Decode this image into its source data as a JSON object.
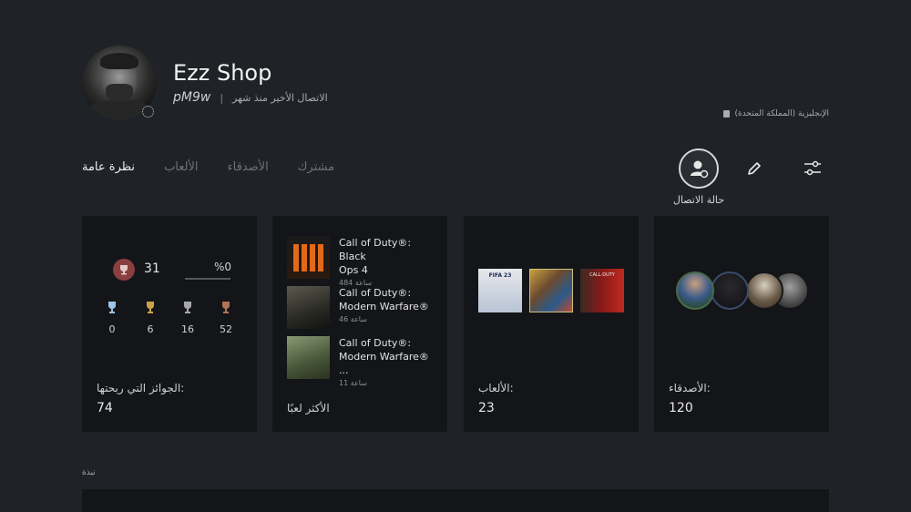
{
  "profile": {
    "username": "Ezz Shop",
    "online_id": "pM9w",
    "last_online": "الاتصال الأخير منذ شهر",
    "separator": "|",
    "region": "الإنجليزية (المملكة المتحدة)"
  },
  "tabs": [
    {
      "label": "نظرة عامة"
    },
    {
      "label": "الألعاب"
    },
    {
      "label": "الأصدقاء"
    },
    {
      "label": "مشترك"
    }
  ],
  "actions": {
    "online_status_label": "حالة الاتصال"
  },
  "trophies": {
    "level": "31",
    "progress_text": "%0",
    "progress_fraction": 0,
    "counts": [
      {
        "type": "platinum",
        "count": "0",
        "color": "#9fc3e6"
      },
      {
        "type": "gold",
        "count": "6",
        "color": "#c9a24a"
      },
      {
        "type": "silver",
        "count": "16",
        "color": "#a8a8a8"
      },
      {
        "type": "bronze",
        "count": "52",
        "color": "#b07456"
      }
    ],
    "label": "الجوائز التي ربحتها:",
    "total": "74"
  },
  "most_played": {
    "label": "الأكثر لعبًا",
    "games": [
      {
        "title_line1": "Call of Duty®: Black",
        "title_line2": "Ops 4",
        "hours": "484 ساعة"
      },
      {
        "title_line1": "Call of Duty®:",
        "title_line2": "Modern Warfare®",
        "hours": "46 ساعة"
      },
      {
        "title_line1": "Call of Duty®:",
        "title_line2": "Modern Warfare® ...",
        "hours": "11 ساعة"
      }
    ]
  },
  "games": {
    "label": "الألعاب:",
    "count": "23",
    "thumb_1_text": "FIFA 23",
    "thumb_3_text": "CALL·DUTY"
  },
  "friends": {
    "label": "الأصدقاء:",
    "count": "120"
  },
  "bio": {
    "label": "نبذة"
  },
  "colors": {
    "background": "#1f2227",
    "card": "#131519",
    "trophy_badge": "#8a3f3f"
  }
}
